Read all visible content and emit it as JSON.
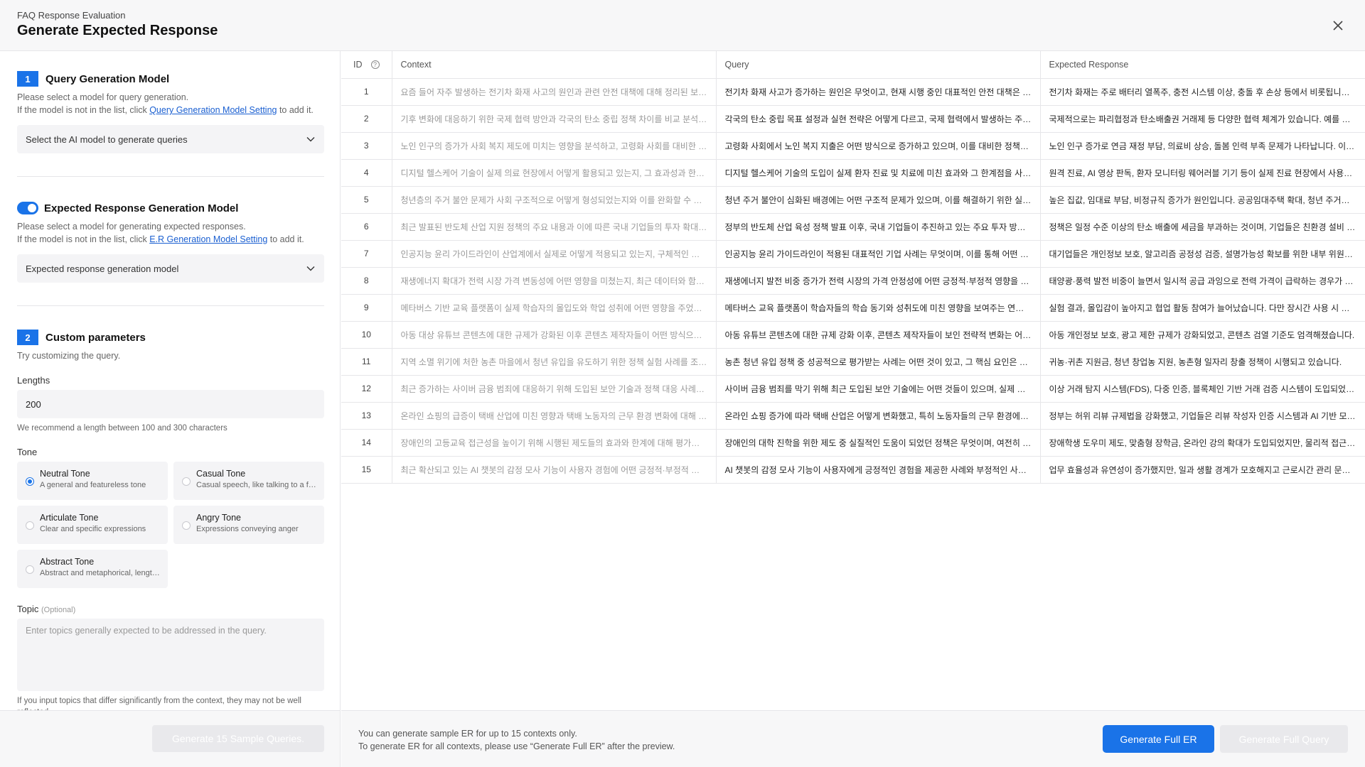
{
  "header": {
    "breadcrumb": "FAQ Response Evaluation",
    "title": "Generate Expected Response",
    "close_icon": "close-icon"
  },
  "left": {
    "section1": {
      "number": "1",
      "title": "Query Generation Model",
      "desc_line1": "Please select a model for query generation.",
      "desc_prefix": "If the model is not in the list, click ",
      "desc_link": "Query Generation Model Setting",
      "desc_suffix": " to add it.",
      "select_placeholder": "Select the AI model to generate queries"
    },
    "er_model": {
      "toggle_on": true,
      "title": "Expected Response Generation Model",
      "desc_line1": "Please select a model for generating expected responses.",
      "desc_prefix": "If the model is not in the list, click ",
      "desc_link": "E.R Generation Model Setting",
      "desc_suffix": " to add it.",
      "select_value": "Expected response generation model"
    },
    "section2": {
      "number": "2",
      "title": "Custom parameters",
      "desc": "Try customizing the query.",
      "lengths_label": "Lengths",
      "lengths_value": "200",
      "lengths_hint": "We recommend a length between 100 and 300 characters",
      "tone_label": "Tone",
      "tones": [
        {
          "title": "Neutral Tone",
          "sub": "A general and featureless tone",
          "selected": true
        },
        {
          "title": "Casual Tone",
          "sub": "Casual speech, like talking to a friend",
          "selected": false
        },
        {
          "title": "Articulate Tone",
          "sub": "Clear and specific expressions",
          "selected": false
        },
        {
          "title": "Angry Tone",
          "sub": "Expressions conveying anger",
          "selected": false
        },
        {
          "title": "Abstract Tone",
          "sub": "Abstract and metaphorical, lengthy expressions",
          "selected": false
        }
      ],
      "topic_label": "Topic",
      "topic_optional": "(Optional)",
      "topic_placeholder": "Enter topics generally expected to be addressed in the query.",
      "topic_hint": "If you input topics that differ significantly from the context, they may not be well reflected."
    },
    "generate_button": "Generate 15 Sample Queries."
  },
  "table": {
    "columns": [
      "ID",
      "Context",
      "Query",
      "Expected Response"
    ],
    "rows": [
      {
        "id": "1",
        "context": "요즘 들어 자주 발생하는 전기차 화재 사고의 원인과 관련 안전 대책에 대해 정리된 보고서입니다",
        "query": "전기차 화재 사고가 증가하는 원인은 무엇이고, 현재 시행 중인 대표적인 안전 대책은 어떤 것이 있나요?",
        "er": "전기차 화재는 주로 배터리 열폭주, 충전 시스템 이상, 충돌 후 손상 등에서 비롯됩니다. 이에 따라"
      },
      {
        "id": "2",
        "context": "기후 변화에 대응하기 위한 국제 협력 방안과 각국의 탄소 중립 정책 차이를 비교 분석한 자료입니다",
        "query": "각국의 탄소 중립 목표 설정과 실현 전략은 어떻게 다르고, 국제 협력에서 발생하는 주요 갈등은 무엇인가요?",
        "er": "국제적으로는 파리협정과 탄소배출권 거래제 등 다양한 협력 체계가 있습니다. 예를 들어"
      },
      {
        "id": "3",
        "context": "노인 인구의 증가가 사회 복지 제도에 미치는 영향을 분석하고, 고령화 사회를 대비한 정책을 제안합니다",
        "query": "고령화 사회에서 노인 복지 지출은 어떤 방식으로 증가하고 있으며, 이를 대비한 정책에는 무엇이 있나요?",
        "er": "노인 인구 증가로 연금 재정 부담, 의료비 상승, 돌봄 인력 부족 문제가 나타납니다. 이를 대비해"
      },
      {
        "id": "4",
        "context": "디지털 헬스케어 기술이 실제 의료 현장에서 어떻게 활용되고 있는지, 그 효과성과 한계를 살펴봅니다",
        "query": "디지털 헬스케어 기술의 도입이 실제 환자 진료 및 치료에 미친 효과와 그 한계점을 사례로 설명해 주세요",
        "er": "원격 진료, AI 영상 판독, 환자 모니터링 웨어러블 기기 등이 실제 진료 현장에서 사용되고 있습니다"
      },
      {
        "id": "5",
        "context": "청년층의 주거 불안 문제가 사회 구조적으로 어떻게 형성되었는지와 이를 완화할 수 있는 방안을 다룹니다",
        "query": "청년 주거 불안이 심화된 배경에는 어떤 구조적 문제가 있으며, 이를 해결하기 위한 실효성 있는 정책은?",
        "er": "높은 집값, 임대료 부담, 비정규직 증가가 원인입니다. 공공임대주택 확대, 청년 주거지원 확대"
      },
      {
        "id": "6",
        "context": "최근 발표된 반도체 산업 지원 정책의 주요 내용과 이에 따른 국내 기업들의 투자 확대 동향입니다",
        "query": "정부의 반도체 산업 육성 정책 발표 이후, 국내 기업들이 추진하고 있는 주요 투자 방향은 무엇인가요?",
        "er": "정책은 일정 수준 이상의 탄소 배출에 세금을 부과하는 것이며, 기업들은 친환경 설비 투자를"
      },
      {
        "id": "7",
        "context": "인공지능 윤리 가이드라인이 산업계에서 실제로 어떻게 적용되고 있는지, 구체적인 사례를 분석합니다",
        "query": "인공지능 윤리 가이드라인이 적용된 대표적인 기업 사례는 무엇이며, 이를 통해 어떤 변화가 있었나요?",
        "er": "대기업들은 개인정보 보호, 알고리즘 공정성 검증, 설명가능성 확보를 위한 내부 위원회를 운영합니다"
      },
      {
        "id": "8",
        "context": "재생에너지 확대가 전력 시장 가격 변동성에 어떤 영향을 미쳤는지, 최근 데이터와 함께 검토합니다",
        "query": "재생에너지 발전 비중 증가가 전력 시장의 가격 안정성에 어떤 긍정적·부정적 영향을 주었나요?",
        "er": "태양광·풍력 발전 비중이 늘면서 일시적 공급 과잉으로 전력 가격이 급락하는 경우가 있습니다"
      },
      {
        "id": "9",
        "context": "메타버스 기반 교육 플랫폼이 실제 학습자의 몰입도와 학업 성취에 어떤 영향을 주었는지 조사합니다",
        "query": "메타버스 교육 플랫폼이 학습자들의 학습 동기와 성취도에 미친 영향을 보여주는 연구 결과가 있나요?",
        "er": "실험 결과, 몰입감이 높아지고 협업 활동 참여가 늘어났습니다. 다만 장시간 사용 시 피로도 증가"
      },
      {
        "id": "10",
        "context": "아동 대상 유튜브 콘텐츠에 대한 규제가 강화된 이후 콘텐츠 제작자들이 어떤 방식으로 대응했는지 봅니다",
        "query": "아동 유튜브 콘텐츠에 대한 규제 강화 이후, 콘텐츠 제작자들이 보인 전략적 변화는 어떤 것이 있나요?",
        "er": "아동 개인정보 보호, 광고 제한 규제가 강화되었고, 콘텐츠 검열 기준도 엄격해졌습니다."
      },
      {
        "id": "11",
        "context": "지역 소멸 위기에 처한 농촌 마을에서 청년 유입을 유도하기 위한 정책 실험 사례를 조사했습니다",
        "query": "농촌 청년 유입 정책 중 성공적으로 평가받는 사례는 어떤 것이 있고, 그 핵심 요인은 무엇인가요?",
        "er": "귀농·귀촌 지원금, 청년 창업농 지원, 농촌형 일자리 창출 정책이 시행되고 있습니다."
      },
      {
        "id": "12",
        "context": "최근 증가하는 사이버 금융 범죄에 대응하기 위해 도입된 보안 기술과 정책 대응 사례를 정리합니다",
        "query": "사이버 금융 범죄를 막기 위해 최근 도입된 보안 기술에는 어떤 것들이 있으며, 실제 사례는?",
        "er": "이상 거래 탐지 시스템(FDS), 다중 인증, 블록체인 기반 거래 검증 시스템이 도입되었습니다"
      },
      {
        "id": "13",
        "context": "온라인 쇼핑의 급증이 택배 산업에 미친 영향과 택배 노동자의 근무 환경 변화에 대해 분석합니다",
        "query": "온라인 쇼핑 증가에 따라 택배 산업은 어떻게 변화했고, 특히 노동자들의 근무 환경에는 어떤 영향이?",
        "er": "정부는 허위 리뷰 규제법을 강화했고, 기업들은 리뷰 작성자 인증 시스템과 AI 기반 모니터링을"
      },
      {
        "id": "14",
        "context": "장애인의 고등교육 접근성을 높이기 위해 시행된 제도들의 효과와 한계에 대해 평가해 봅니다",
        "query": "장애인의 대학 진학을 위한 제도 중 실질적인 도움이 되었던 정책은 무엇이며, 여전히 부족한 점은?",
        "er": "장애학생 도우미 제도, 맞춤형 장학금, 온라인 강의 확대가 도입되었지만, 물리적 접근성은 여전히"
      },
      {
        "id": "15",
        "context": "최근 확산되고 있는 AI 챗봇의 감정 모사 기능이 사용자 경험에 어떤 긍정적·부정적 영향을 주는지",
        "query": "AI 챗봇의 감정 모사 기능이 사용자에게 긍정적인 경험을 제공한 사례와 부정적인 사례는 무엇인가요?",
        "er": "업무 효율성과 유연성이 증가했지만, 일과 생활 경계가 모호해지고 근로시간 관리 문제가 생겼습니다"
      }
    ]
  },
  "footer": {
    "note_line1": "You can generate sample ER for up to 15 contexts only.",
    "note_line2": "To generate ER  for all contexts, please use “Generate Full ER” after the preview.",
    "generate_full_er": "Generate Full ER",
    "generate_full_query": "Generate Full Query"
  },
  "colors": {
    "accent": "#1a73e8",
    "disabled": "#e9e9ec"
  }
}
